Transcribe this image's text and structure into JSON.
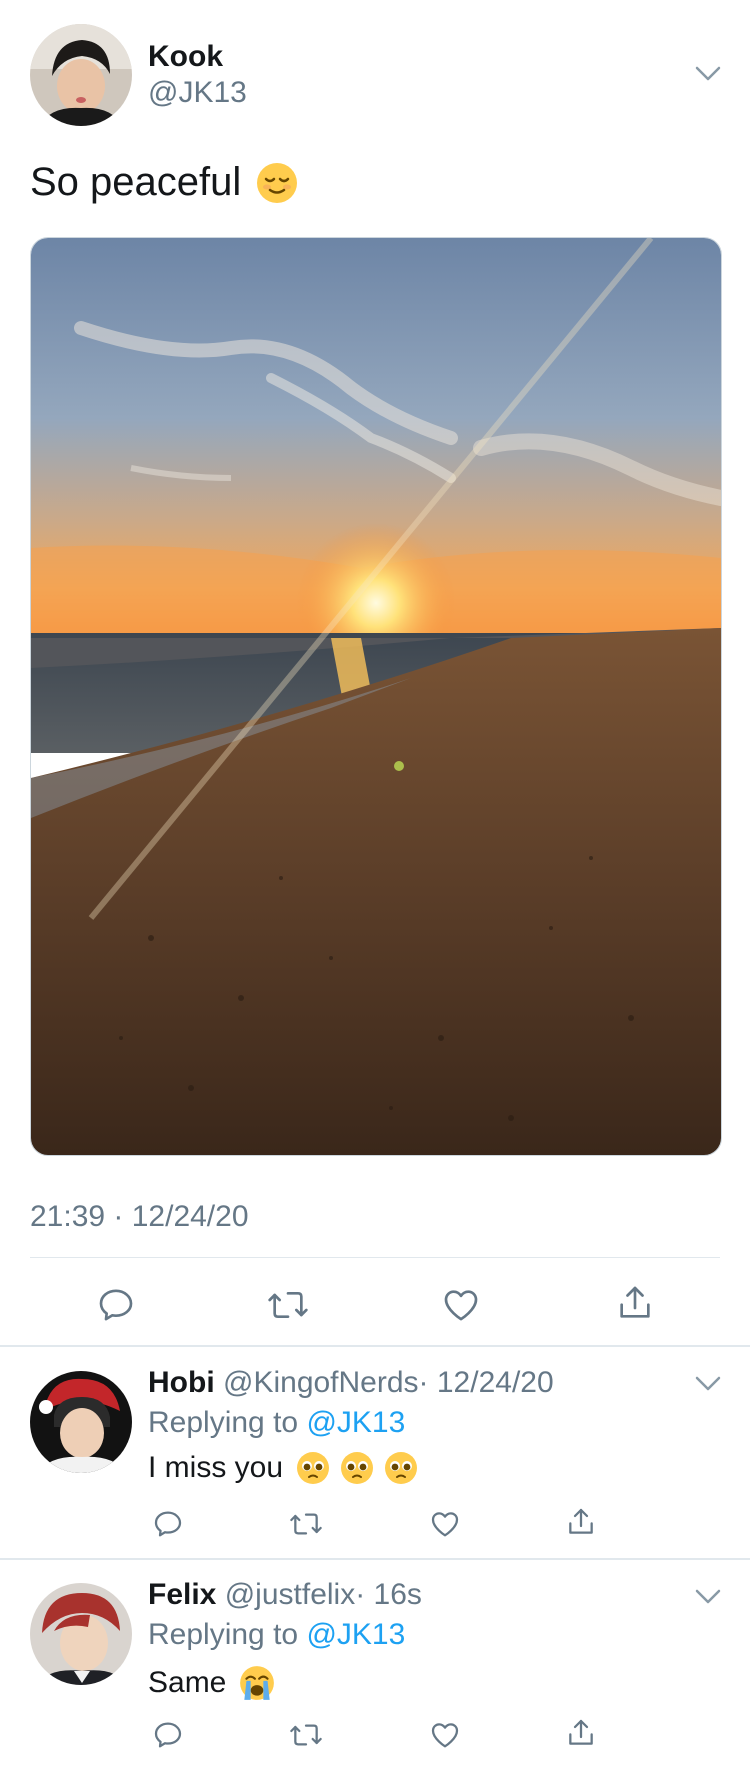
{
  "main_tweet": {
    "author_name": "Kook",
    "author_handle": "@JK13",
    "text": "So peaceful",
    "timestamp": "21:39 · 12/24/20",
    "photo_subject": "sunset-over-beach",
    "avatar_icon": "avatar-kook"
  },
  "replies": [
    {
      "author_name": "Hobi",
      "author_handle": "@KingofNerds",
      "time": "· 12/24/20",
      "replying_prefix": "Replying to",
      "replying_target": "@JK13",
      "text": "I miss you",
      "emojis": [
        "pleading-face",
        "pleading-face",
        "pleading-face"
      ]
    },
    {
      "author_name": "Felix",
      "author_handle": "@justfelix",
      "time": "· 16s",
      "replying_prefix": "Replying to",
      "replying_target": "@JK13",
      "text": "Same",
      "emojis": [
        "loudly-crying-face"
      ]
    }
  ],
  "icons": {
    "reply": "reply-icon",
    "retweet": "retweet-icon",
    "like": "like-icon",
    "share": "share-icon",
    "more": "chevron-down-icon"
  },
  "colors": {
    "link_blue": "#1da1f2",
    "gray": "#657786",
    "divider": "#e1e8ed"
  }
}
